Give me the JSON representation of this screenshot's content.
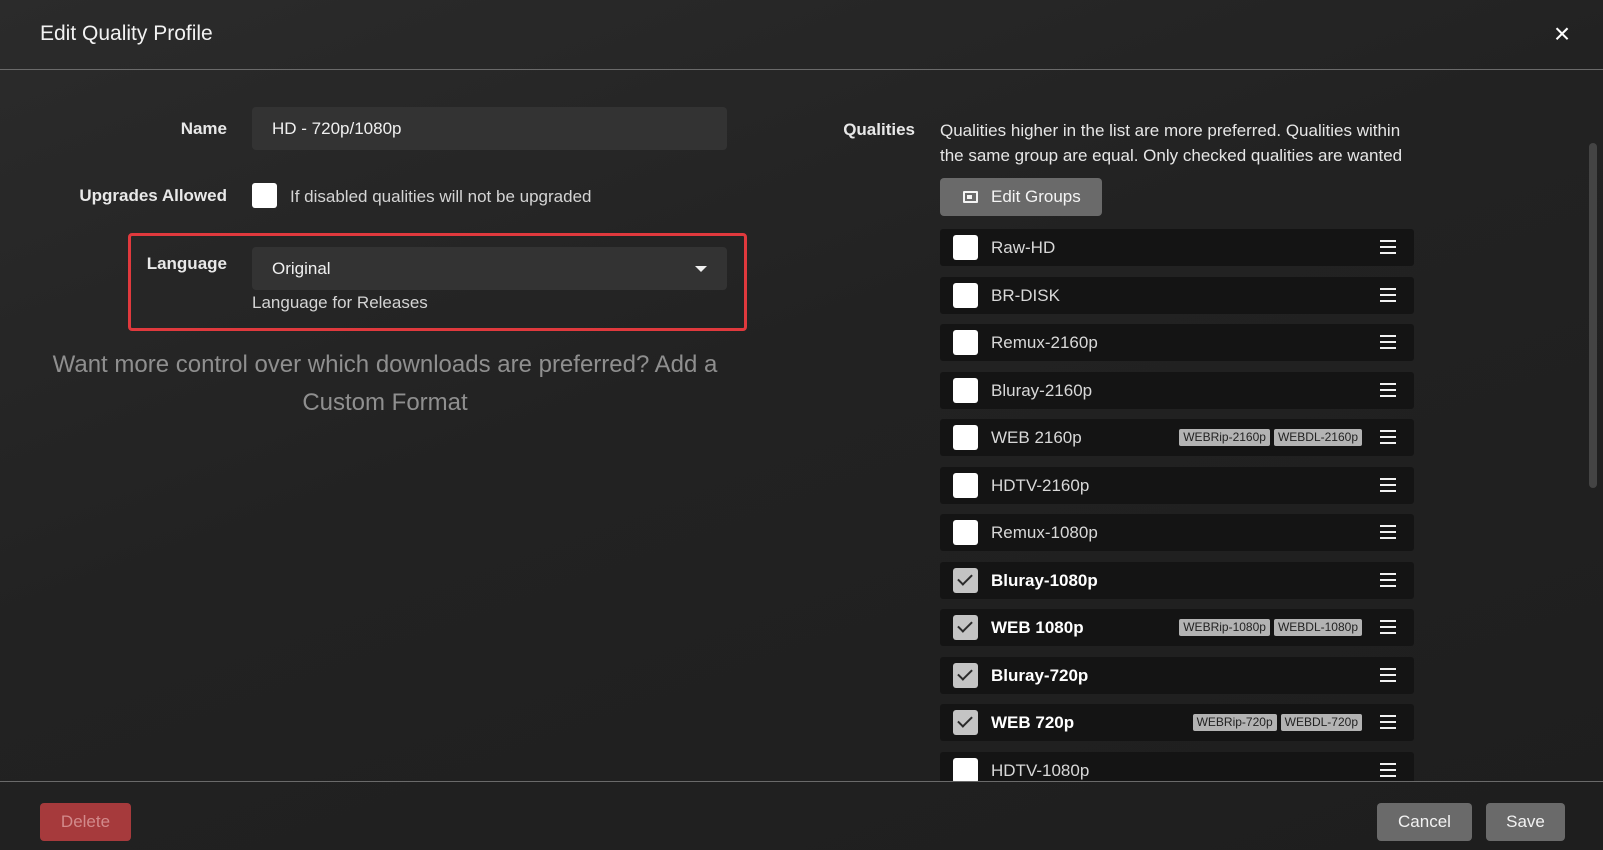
{
  "header": {
    "title": "Edit Quality Profile",
    "close_glyph": "×"
  },
  "form": {
    "name_label": "Name",
    "name_value": "HD - 720p/1080p",
    "upgrades_label": "Upgrades Allowed",
    "upgrades_help": "If disabled qualities will not be upgraded",
    "language_label": "Language",
    "language_value": "Original",
    "language_help": "Language for Releases"
  },
  "promo": {
    "text": "Want more control over which downloads are preferred? Add a Custom Format"
  },
  "qualities": {
    "label": "Qualities",
    "help": "Qualities higher in the list are more preferred. Qualities within the same group are equal. Only checked qualities are wanted",
    "edit_groups_label": "Edit Groups",
    "items": [
      {
        "name": "Raw-HD",
        "checked": false,
        "badges": []
      },
      {
        "name": "BR-DISK",
        "checked": false,
        "badges": []
      },
      {
        "name": "Remux-2160p",
        "checked": false,
        "badges": []
      },
      {
        "name": "Bluray-2160p",
        "checked": false,
        "badges": []
      },
      {
        "name": "WEB 2160p",
        "checked": false,
        "badges": [
          "WEBRip-2160p",
          "WEBDL-2160p"
        ]
      },
      {
        "name": "HDTV-2160p",
        "checked": false,
        "badges": []
      },
      {
        "name": "Remux-1080p",
        "checked": false,
        "badges": []
      },
      {
        "name": "Bluray-1080p",
        "checked": true,
        "badges": []
      },
      {
        "name": "WEB 1080p",
        "checked": true,
        "badges": [
          "WEBRip-1080p",
          "WEBDL-1080p"
        ]
      },
      {
        "name": "Bluray-720p",
        "checked": true,
        "badges": []
      },
      {
        "name": "WEB 720p",
        "checked": true,
        "badges": [
          "WEBRip-720p",
          "WEBDL-720p"
        ]
      },
      {
        "name": "HDTV-1080p",
        "checked": false,
        "badges": []
      }
    ]
  },
  "footer": {
    "delete_label": "Delete",
    "cancel_label": "Cancel",
    "save_label": "Save"
  },
  "colors": {
    "highlight_border": "#e0393d",
    "delete_bg": "#a63a3c",
    "button_bg": "#6a6a6a"
  }
}
